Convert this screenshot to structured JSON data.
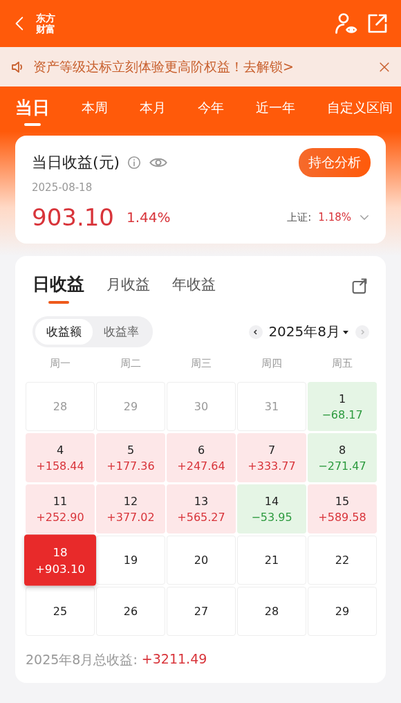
{
  "header": {
    "logo": [
      "东方",
      "财富"
    ]
  },
  "notice": {
    "text": "资产等级达标立刻体验更高阶权益！去解锁>"
  },
  "period_tabs": [
    {
      "label": "当日",
      "selected": true
    },
    {
      "label": "本周",
      "selected": false
    },
    {
      "label": "本月",
      "selected": false
    },
    {
      "label": "今年",
      "selected": false
    },
    {
      "label": "近一年",
      "selected": false
    },
    {
      "label": "自定义区间",
      "selected": false
    }
  ],
  "summary": {
    "title": "当日收益(元)",
    "date": "2025-08-18",
    "button": "持仓分析",
    "amount": "903.10",
    "percent": "1.44%",
    "index_label": "上证:",
    "index_value": "1.18%"
  },
  "income_tabs": [
    {
      "label": "日收益",
      "selected": true
    },
    {
      "label": "月收益",
      "selected": false
    },
    {
      "label": "年收益",
      "selected": false
    }
  ],
  "toggle": [
    {
      "label": "收益额",
      "selected": true
    },
    {
      "label": "收益率",
      "selected": false
    }
  ],
  "month": "2025年8月",
  "weekdays": [
    "周一",
    "周二",
    "周三",
    "周四",
    "周五"
  ],
  "days": [
    {
      "day": "28",
      "kind": "none",
      "selected": false
    },
    {
      "day": "29",
      "kind": "none",
      "selected": false
    },
    {
      "day": "30",
      "kind": "none",
      "selected": false
    },
    {
      "day": "31",
      "kind": "none",
      "selected": false
    },
    {
      "day": "1",
      "value": "−68.17",
      "kind": "down",
      "selected": false
    },
    {
      "day": "4",
      "value": "+158.44",
      "kind": "up",
      "selected": false
    },
    {
      "day": "5",
      "value": "+177.36",
      "kind": "up",
      "selected": false
    },
    {
      "day": "6",
      "value": "+247.64",
      "kind": "up",
      "selected": false
    },
    {
      "day": "7",
      "value": "+333.77",
      "kind": "up",
      "selected": false
    },
    {
      "day": "8",
      "value": "−271.47",
      "kind": "down",
      "selected": false
    },
    {
      "day": "11",
      "value": "+252.90",
      "kind": "up",
      "selected": false
    },
    {
      "day": "12",
      "value": "+377.02",
      "kind": "up",
      "selected": false
    },
    {
      "day": "13",
      "value": "+565.27",
      "kind": "up",
      "selected": false
    },
    {
      "day": "14",
      "value": "−53.95",
      "kind": "down",
      "selected": false
    },
    {
      "day": "15",
      "value": "+589.58",
      "kind": "up",
      "selected": false
    },
    {
      "day": "18",
      "value": "+903.10",
      "kind": "up",
      "selected": true
    },
    {
      "day": "19",
      "kind": "future",
      "selected": false
    },
    {
      "day": "20",
      "kind": "future",
      "selected": false
    },
    {
      "day": "21",
      "kind": "future",
      "selected": false
    },
    {
      "day": "22",
      "kind": "future",
      "selected": false
    },
    {
      "day": "25",
      "kind": "future",
      "selected": false
    },
    {
      "day": "26",
      "kind": "future",
      "selected": false
    },
    {
      "day": "27",
      "kind": "future",
      "selected": false
    },
    {
      "day": "28",
      "kind": "future",
      "selected": false
    },
    {
      "day": "29",
      "kind": "future",
      "selected": false
    }
  ],
  "total": {
    "label": "2025年8月总收益:",
    "value": "+3211.49"
  }
}
